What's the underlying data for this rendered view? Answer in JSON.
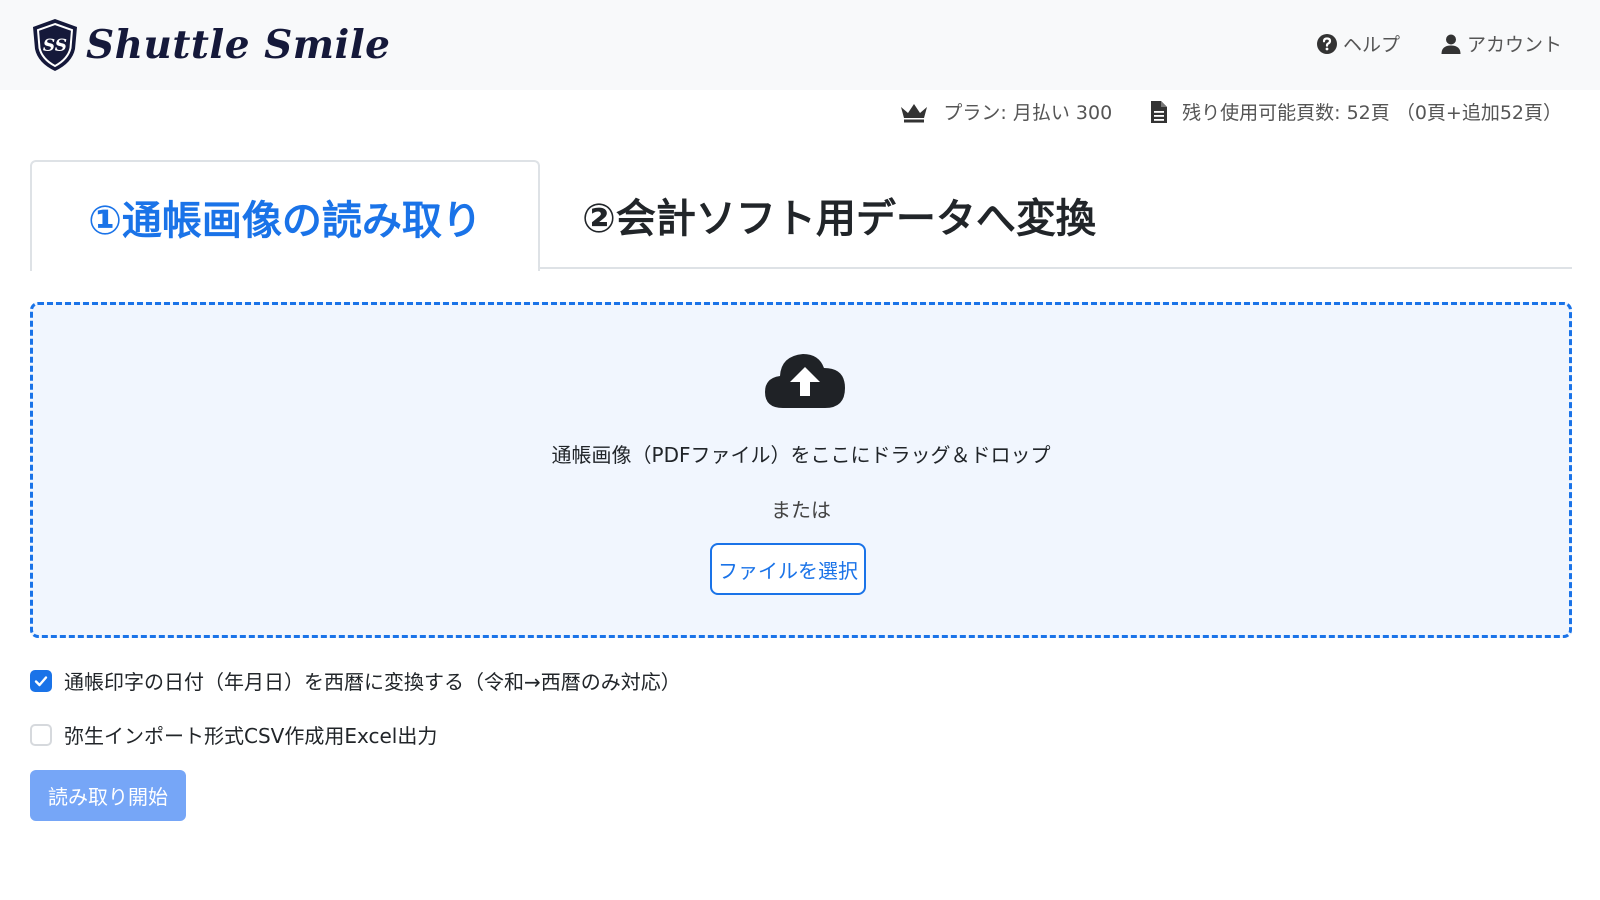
{
  "brand": {
    "name": "Shuttle Smile",
    "logo_initials": "SS"
  },
  "nav": {
    "help_label": "ヘルプ",
    "help_icon": "question-circle-icon",
    "account_label": "アカウント",
    "account_icon": "user-icon"
  },
  "plan": {
    "plan_icon": "crown-icon",
    "plan_label": "プラン: 月払い 300",
    "pages_icon": "document-icon",
    "pages_label": "残り使用可能頁数: 52頁 （0頁+追加52頁）"
  },
  "tabs": [
    {
      "label": "①通帳画像の読み取り",
      "active": true
    },
    {
      "label": "②会計ソフト用データへ変換",
      "active": false
    }
  ],
  "dropzone": {
    "icon": "cloud-upload-icon",
    "instruction": "通帳画像（PDFファイル）をここにドラッグ＆ドロップ",
    "or_text": "または",
    "select_button": "ファイルを選択"
  },
  "options": [
    {
      "label": "通帳印字の日付（年月日）を西暦に変換する（令和→西暦のみ対応）",
      "checked": true
    },
    {
      "label": "弥生インポート形式CSV作成用Excel出力",
      "checked": false
    }
  ],
  "start_button": "読み取り開始",
  "colors": {
    "primary": "#1a73e8",
    "primary_disabled": "#76a6f7",
    "navbar_bg": "#f8f9fa",
    "dropzone_bg": "#f1f6fe",
    "brand_text": "#15193a"
  }
}
